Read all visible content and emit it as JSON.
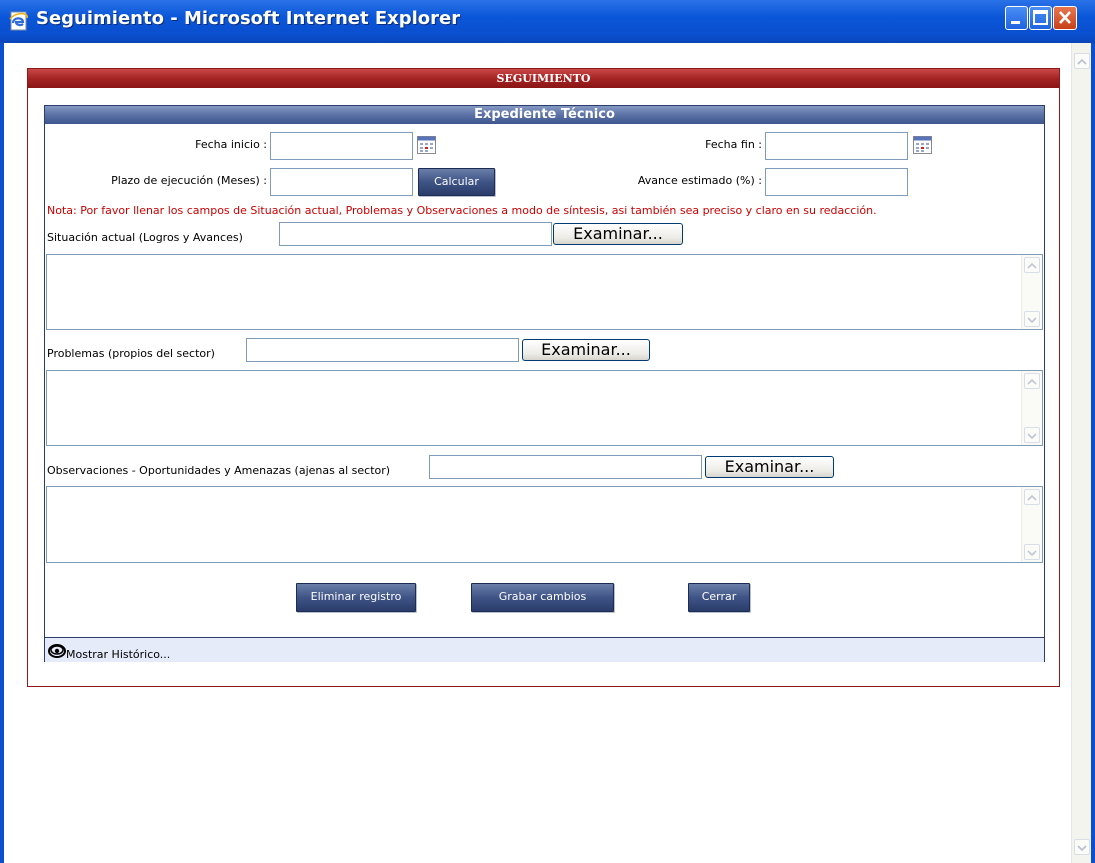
{
  "window": {
    "title": "Seguimiento - Microsoft Internet Explorer"
  },
  "panel": {
    "title": "SEGUIMIENTO"
  },
  "section": {
    "title": "Expediente Técnico"
  },
  "form": {
    "fecha_inicio_label": "Fecha inicio :",
    "fecha_inicio_value": "",
    "fecha_fin_label": "Fecha fin :",
    "fecha_fin_value": "",
    "plazo_label": "Plazo de ejecución (Meses) :",
    "plazo_value": "",
    "calcular_label": "Calcular",
    "avance_label": "Avance estimado (%) :",
    "avance_value": "",
    "note": "Nota: Por favor llenar los campos de Situación actual, Problemas y Observaciones a modo de síntesis, asi también sea preciso y claro en su redacción.",
    "situacion_label": "Situación actual (Logros y Avances)",
    "problemas_label": "Problemas (propios del sector)",
    "observaciones_label": "Observaciones - Oportunidades y Amenazas (ajenas al sector)",
    "browse_label": "Examinar..."
  },
  "actions": {
    "eliminar": "Eliminar registro",
    "grabar": "Grabar cambios",
    "cerrar": "Cerrar"
  },
  "history": {
    "label": "Mostrar Histórico..."
  },
  "colors": {
    "panel_header": "#a52424",
    "section_header": "#5b72a6",
    "note_text": "#cc0000"
  }
}
